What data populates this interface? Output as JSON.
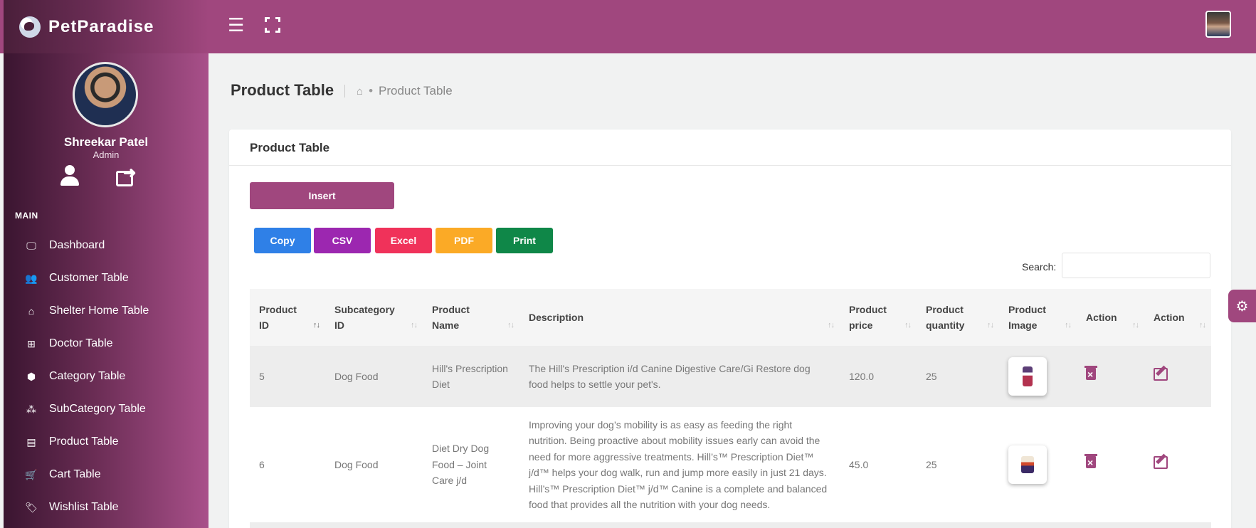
{
  "brand": {
    "name": "PetParadise"
  },
  "profile": {
    "name": "Shreekar Patel",
    "role": "Admin"
  },
  "sidebar": {
    "section_title": "MAIN",
    "items": [
      {
        "label": "Dashboard",
        "icon": "monitor-icon"
      },
      {
        "label": "Customer Table",
        "icon": "users-icon"
      },
      {
        "label": "Shelter Home Table",
        "icon": "home-icon"
      },
      {
        "label": "Doctor Table",
        "icon": "medical-plus-icon"
      },
      {
        "label": "Category Table",
        "icon": "box-icon"
      },
      {
        "label": "SubCategory Table",
        "icon": "cubes-icon"
      },
      {
        "label": "Product Table",
        "icon": "archive-icon"
      },
      {
        "label": "Cart Table",
        "icon": "cart-icon"
      },
      {
        "label": "Wishlist Table",
        "icon": "tags-icon"
      }
    ]
  },
  "page": {
    "title": "Product Table",
    "breadcrumb": {
      "current": "Product Table"
    }
  },
  "card": {
    "title": "Product Table",
    "insert_label": "Insert",
    "export_buttons": [
      {
        "label": "Copy",
        "color": "#2f80e7"
      },
      {
        "label": "CSV",
        "color": "#9c27b0"
      },
      {
        "label": "Excel",
        "color": "#f0325a"
      },
      {
        "label": "PDF",
        "color": "#fbaa26"
      },
      {
        "label": "Print",
        "color": "#0f8748"
      }
    ],
    "search_label": "Search:",
    "search_value": ""
  },
  "table": {
    "headers": [
      [
        "Product",
        "ID"
      ],
      [
        "Subcategory",
        "ID"
      ],
      [
        "Product",
        "Name"
      ],
      [
        "Description"
      ],
      [
        "Product",
        "price"
      ],
      [
        "Product",
        "quantity"
      ],
      [
        "Product",
        "Image"
      ],
      [
        "Action"
      ],
      [
        "Action"
      ]
    ],
    "rows": [
      {
        "product_id": "5",
        "subcategory_id": "Dog Food",
        "product_name": "Hill's Prescription Diet",
        "description": "The Hill's Prescription i/d Canine Digestive Care/Gi Restore dog food helps to settle your pet's.",
        "price": "120.0",
        "quantity": "25"
      },
      {
        "product_id": "6",
        "subcategory_id": "Dog Food",
        "product_name": "Diet Dry Dog Food – Joint Care j/d",
        "description": "Improving your dog’s mobility is as easy as feeding the right nutrition. Being proactive about mobility issues early can avoid the need for more aggressive treatments. Hill’s™ Prescription Diet™ j/d™ helps your dog walk, run and jump more easily in just 21 days. Hill’s™ Prescription Diet™ j/d™ Canine is a complete and balanced food that provides all the nutrition with your dog needs.",
        "price": "45.0",
        "quantity": "25"
      }
    ]
  },
  "theme": {
    "primary": "#a0477e"
  }
}
